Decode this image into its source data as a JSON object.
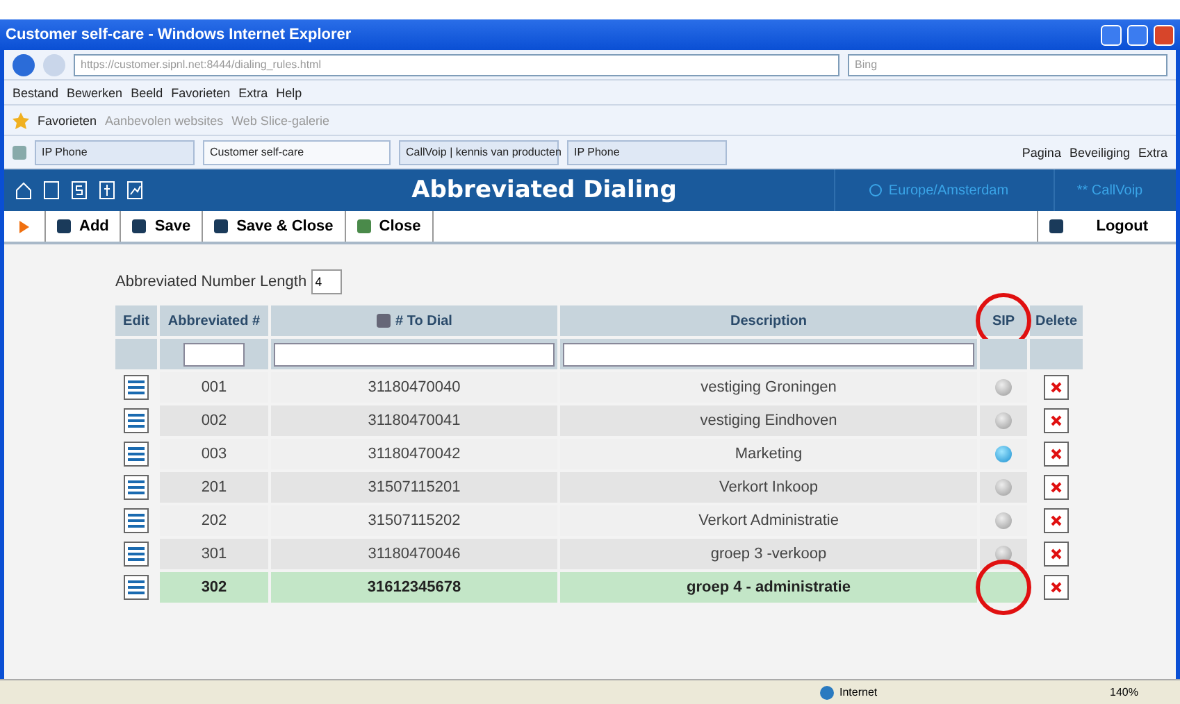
{
  "window": {
    "title": "Customer self-care - Windows Internet Explorer"
  },
  "address": {
    "url": "https://customer.sipnl.net:8444/dialing_rules.html",
    "search_placeholder": "Bing"
  },
  "menu": [
    "Bestand",
    "Bewerken",
    "Beeld",
    "Favorieten",
    "Extra",
    "Help"
  ],
  "favorites": {
    "label": "Favorieten",
    "links": [
      "Aanbevolen websites",
      "Web Slice-galerie"
    ]
  },
  "browser_tabs": [
    {
      "label": "IP Phone",
      "selected": false
    },
    {
      "label": "Customer self-care",
      "selected": true
    },
    {
      "label": "CallVoip | kennis van producten",
      "selected": false
    },
    {
      "label": "IP Phone",
      "selected": false
    }
  ],
  "command_bar": [
    "Pagina",
    "Beveiliging",
    "Extra"
  ],
  "app_header": {
    "title": "Abbreviated Dialing",
    "timezone": "Europe/Amsterdam",
    "user": "** CallVoip"
  },
  "toolbar": [
    "Add",
    "Save",
    "Save & Close",
    "Close"
  ],
  "logout": "Logout",
  "length_field": {
    "label": "Abbreviated Number Length",
    "value": "4"
  },
  "table": {
    "columns": [
      {
        "label": "Edit",
        "highlighted": false
      },
      {
        "label": "Abbreviated #",
        "highlighted": false
      },
      {
        "label": "# To Dial",
        "highlighted": false
      },
      {
        "label": "Description",
        "highlighted": false
      },
      {
        "label": "SIP",
        "highlighted": true
      },
      {
        "label": "Delete",
        "highlighted": false
      }
    ],
    "rows": [
      {
        "abbr": "001",
        "dial": "31180470040",
        "description": "vestiging Groningen",
        "sip_active": false,
        "selected": false,
        "sip_highlighted": false
      },
      {
        "abbr": "002",
        "dial": "31180470041",
        "description": "vestiging Eindhoven",
        "sip_active": false,
        "selected": false,
        "sip_highlighted": false
      },
      {
        "abbr": "003",
        "dial": "31180470042",
        "description": "Marketing",
        "sip_active": true,
        "selected": false,
        "sip_highlighted": false
      },
      {
        "abbr": "201",
        "dial": "31507115201",
        "description": "Verkort Inkoop",
        "sip_active": false,
        "selected": false,
        "sip_highlighted": false
      },
      {
        "abbr": "202",
        "dial": "31507115202",
        "description": "Verkort Administratie",
        "sip_active": false,
        "selected": false,
        "sip_highlighted": false
      },
      {
        "abbr": "301",
        "dial": "31180470046",
        "description": "groep 3 -verkoop",
        "sip_active": false,
        "selected": false,
        "sip_highlighted": false
      },
      {
        "abbr": "302",
        "dial": "31612345678",
        "description": "groep 4 - administratie",
        "selected": true,
        "sip_highlighted": true
      }
    ]
  },
  "status_bar": {
    "zone": "Internet",
    "zoom": "140%"
  }
}
